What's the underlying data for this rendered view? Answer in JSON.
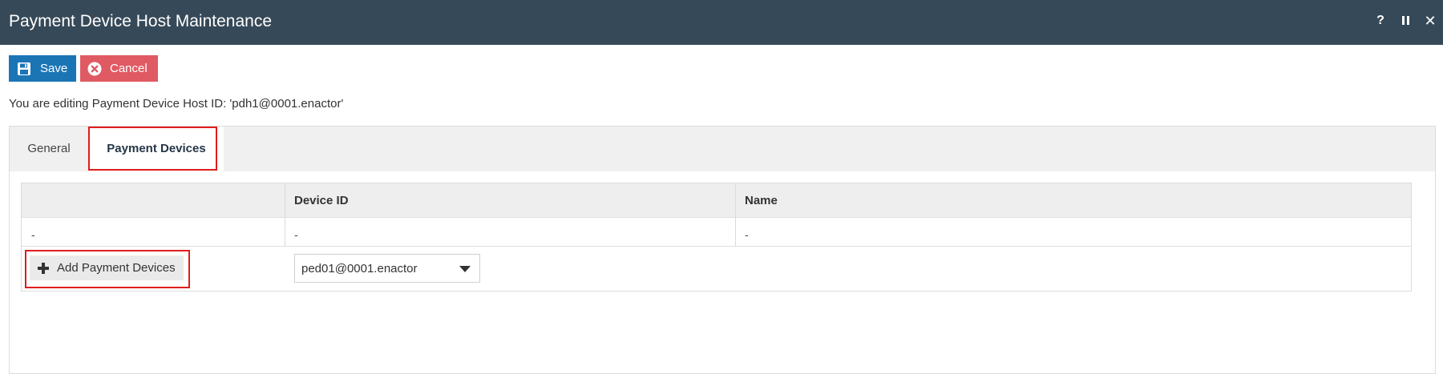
{
  "window": {
    "title": "Payment Device Host Maintenance",
    "help_label": "?",
    "close_label": "✕"
  },
  "toolbar": {
    "save_label": "Save",
    "cancel_label": "Cancel"
  },
  "editing_message": "You are editing Payment Device Host ID: 'pdh1@0001.enactor'",
  "tabs": [
    {
      "label": "General",
      "active": false
    },
    {
      "label": "Payment Devices",
      "active": true
    }
  ],
  "table": {
    "columns": [
      "",
      "Device ID",
      "Name"
    ],
    "rows": [
      [
        "-",
        "-",
        "-"
      ]
    ]
  },
  "add_row": {
    "button_label": "Add Payment Devices",
    "selected_device": "ped01@0001.enactor"
  },
  "colors": {
    "titlebar": "#364958",
    "save": "#1b75b5",
    "cancel": "#e05a63",
    "highlight": "#e11c1c"
  }
}
